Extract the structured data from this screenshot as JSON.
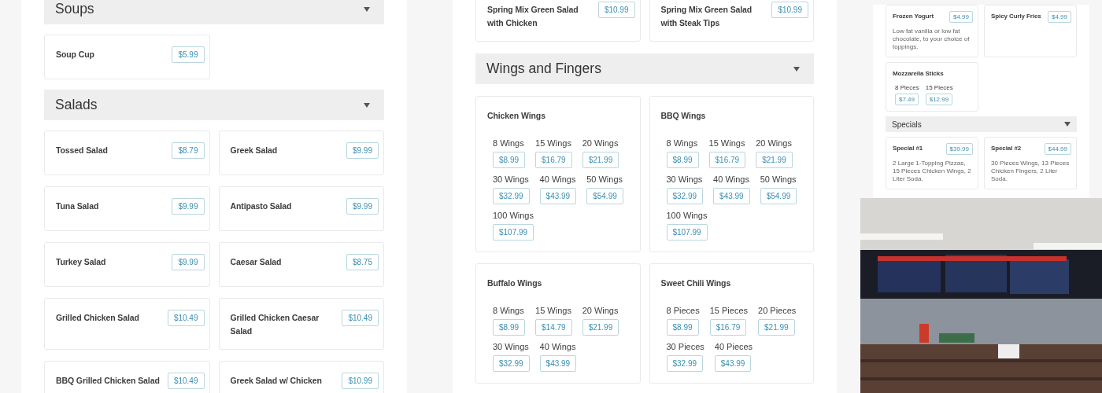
{
  "panels": [
    {
      "kind": "menu",
      "sections": [
        {
          "title": "Soups",
          "items": [
            {
              "name": "Soup Cup",
              "price": "$5.99"
            }
          ]
        },
        {
          "title": "Salads",
          "items": [
            {
              "name": "Tossed Salad",
              "price": "$8.79"
            },
            {
              "name": "Greek Salad",
              "price": "$9.99"
            },
            {
              "name": "Tuna Salad",
              "price": "$9.99"
            },
            {
              "name": "Antipasto Salad",
              "price": "$9.99"
            },
            {
              "name": "Turkey Salad",
              "price": "$9.99"
            },
            {
              "name": "Caesar Salad",
              "price": "$8.75"
            },
            {
              "name": "Grilled Chicken Salad",
              "price": "$10.49"
            },
            {
              "name": "Grilled Chicken Caesar Salad",
              "price": "$10.49"
            },
            {
              "name": "BBQ Grilled Chicken Salad",
              "price": "$10.49"
            },
            {
              "name": "Greek Salad w/ Chicken",
              "price": "$10.99"
            }
          ]
        }
      ]
    },
    {
      "kind": "menu",
      "sections": [
        {
          "items": [
            {
              "name": "Spring Mix Green Salad with Chicken",
              "price": "$10.99"
            },
            {
              "name": "Spring Mix Green Salad with Steak Tips",
              "price": "$10.99"
            }
          ]
        },
        {
          "title": "Wings and Fingers",
          "items": [
            {
              "name": "Chicken Wings",
              "options": [
                {
                  "label": "8 Wings",
                  "price": "$8.99"
                },
                {
                  "label": "15 Wings",
                  "price": "$16.79"
                },
                {
                  "label": "20 Wings",
                  "price": "$21.99"
                },
                {
                  "label": "30 Wings",
                  "price": "$32.99"
                },
                {
                  "label": "40 Wings",
                  "price": "$43.99"
                },
                {
                  "label": "50 Wings",
                  "price": "$54.99"
                },
                {
                  "label": "100 Wings",
                  "price": "$107.99"
                }
              ]
            },
            {
              "name": "BBQ Wings",
              "options": [
                {
                  "label": "8 Wings",
                  "price": "$8.99"
                },
                {
                  "label": "15 Wings",
                  "price": "$16.79"
                },
                {
                  "label": "20 Wings",
                  "price": "$21.99"
                },
                {
                  "label": "30 Wings",
                  "price": "$32.99"
                },
                {
                  "label": "40 Wings",
                  "price": "$43.99"
                },
                {
                  "label": "50 Wings",
                  "price": "$54.99"
                },
                {
                  "label": "100 Wings",
                  "price": "$107.99"
                }
              ]
            },
            {
              "name": "Buffalo Wings",
              "options": [
                {
                  "label": "8 Wings",
                  "price": "$8.99"
                },
                {
                  "label": "15 Wings",
                  "price": "$14.79"
                },
                {
                  "label": "20 Wings",
                  "price": "$21.99"
                },
                {
                  "label": "30 Wings",
                  "price": "$32.99"
                },
                {
                  "label": "40 Wings",
                  "price": "$43.99"
                }
              ]
            },
            {
              "name": "Sweet Chili Wings",
              "options": [
                {
                  "label": "8 Pieces",
                  "price": "$8.99"
                },
                {
                  "label": "15 Pieces",
                  "price": "$16.79"
                },
                {
                  "label": "20 Pieces",
                  "price": "$21.99"
                },
                {
                  "label": "30 Pieces",
                  "price": "$32.99"
                },
                {
                  "label": "40 Pieces",
                  "price": "$43.99"
                }
              ]
            }
          ]
        }
      ]
    },
    {
      "kind": "mini",
      "sections": [
        {
          "items": [
            {
              "name": "Frozen Yogurt",
              "price": "$4.99",
              "description": "Low fat vanilla or low fat chocolate, to your choice of toppings."
            },
            {
              "name": "Spicy Curly Fries",
              "price": "$4.99"
            },
            {
              "name": "Mozzarella Sticks",
              "options": [
                {
                  "label": "8 Pieces",
                  "price": "$7.49"
                },
                {
                  "label": "15 Pieces",
                  "price": "$12.99"
                }
              ]
            }
          ]
        },
        {
          "title": "Specials",
          "items": [
            {
              "name": "Special #1",
              "price": "$39.99",
              "description": "2 Large 1-Topping Pizzas, 15 Pieces Chicken Wings, 2 Liter Soda."
            },
            {
              "name": "Special #2",
              "price": "$44.99",
              "description": "30 Pieces Wings, 13 Pieces Chicken Fingers, 2 Liter Soda."
            }
          ]
        }
      ]
    }
  ]
}
